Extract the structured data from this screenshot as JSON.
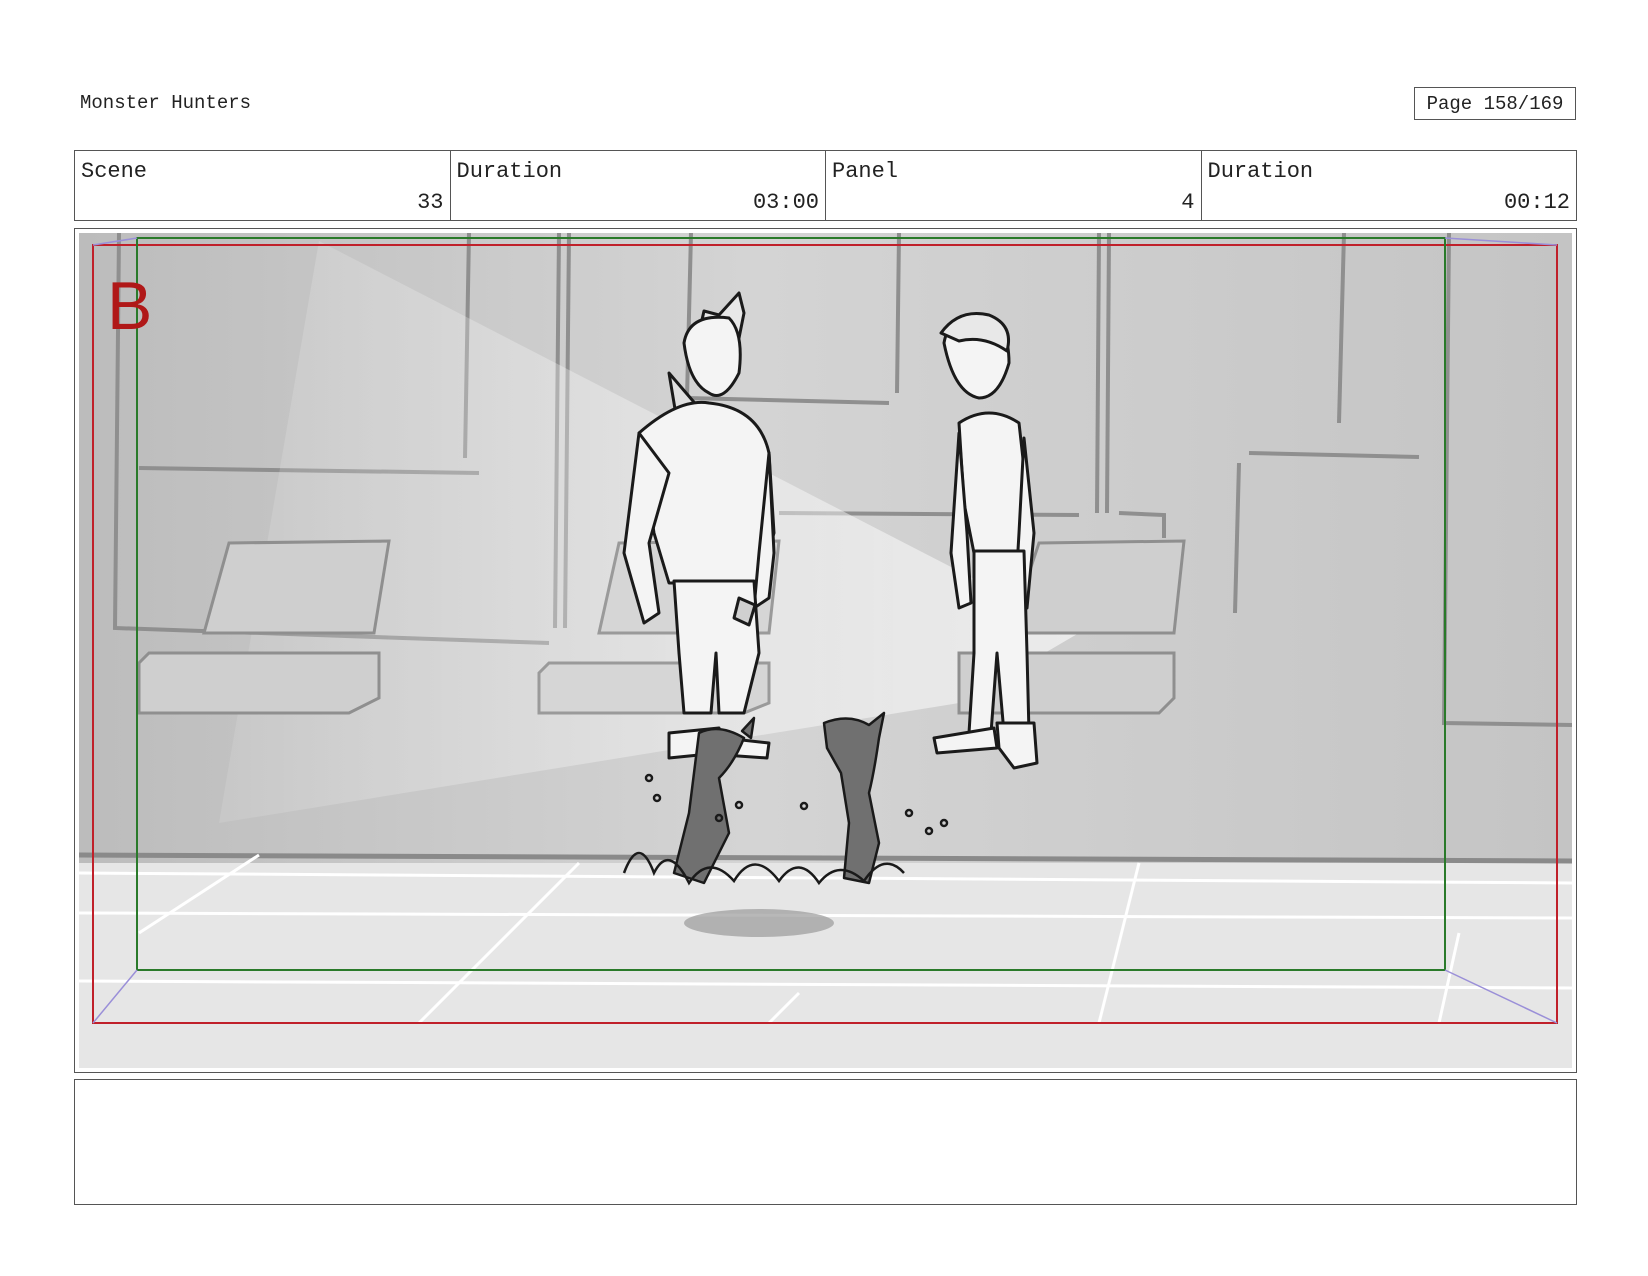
{
  "header": {
    "project_title": "Monster Hunters",
    "page_label": "Page 158/169"
  },
  "info": {
    "scene_label": "Scene",
    "scene_value": "33",
    "scene_duration_label": "Duration",
    "scene_duration_value": "03:00",
    "panel_label": "Panel",
    "panel_value": "4",
    "panel_duration_label": "Duration",
    "panel_duration_value": "00:12"
  },
  "panel": {
    "marker_letter": "B",
    "colors": {
      "safe_frame": "#c0202a",
      "action_frame": "#2a7a2a",
      "marker": "#b01818",
      "guides": "#9a8fd8"
    }
  },
  "notes": {
    "text": ""
  }
}
